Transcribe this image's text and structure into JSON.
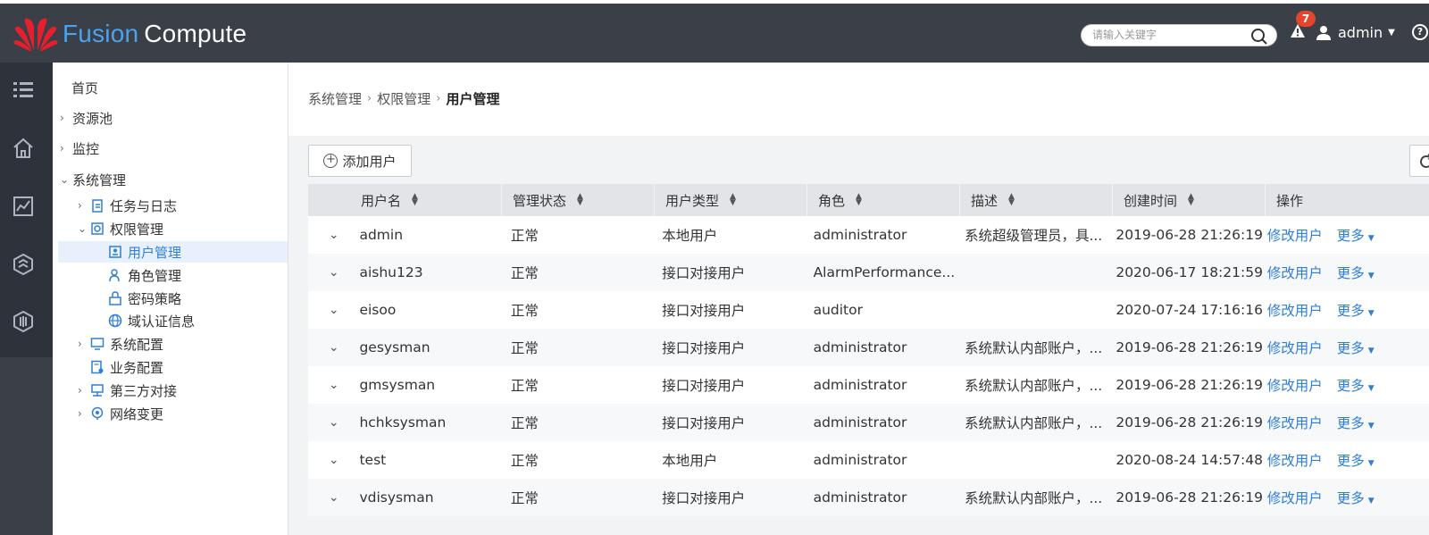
{
  "header": {
    "brand_part1": "Fusion",
    "brand_part2": "Compute",
    "search_placeholder": "请输入关键字",
    "alarm_count": "7",
    "user_name": "admin",
    "help_symbol": "?"
  },
  "rail_icons": [
    "list-icon",
    "home-icon",
    "monitor-chart-icon",
    "hexagon-icon",
    "shield-icon"
  ],
  "tree": {
    "home": "首页",
    "resource_pool": "资源池",
    "monitor": "监控",
    "system_mgmt": "系统管理",
    "task_log": "任务与日志",
    "permission_mgmt": "权限管理",
    "user_mgmt": "用户管理",
    "role_mgmt": "角色管理",
    "password_policy": "密码策略",
    "domain_auth": "域认证信息",
    "system_config": "系统配置",
    "business_config": "业务配置",
    "third_party": "第三方对接",
    "network_change": "网络变更"
  },
  "breadcrumb": {
    "level1": "系统管理",
    "level2": "权限管理",
    "current": "用户管理"
  },
  "toolbar": {
    "add_user": "添加用户"
  },
  "table": {
    "columns": {
      "username": "用户名",
      "status": "管理状态",
      "user_type": "用户类型",
      "role": "角色",
      "description": "描述",
      "created": "创建时间",
      "actions": "操作"
    },
    "action_edit": "修改用户",
    "action_more": "更多",
    "rows": [
      {
        "username": "admin",
        "status": "正常",
        "user_type": "本地用户",
        "role": "administrator",
        "description": "系统超级管理员，具...",
        "created": "2019-06-28 21:26:19"
      },
      {
        "username": "aishu123",
        "status": "正常",
        "user_type": "接口对接用户",
        "role": "AlarmPerformance...",
        "description": "",
        "created": "2020-06-17 18:21:59"
      },
      {
        "username": "eisoo",
        "status": "正常",
        "user_type": "接口对接用户",
        "role": "auditor",
        "description": "",
        "created": "2020-07-24 17:16:16"
      },
      {
        "username": "gesysman",
        "status": "正常",
        "user_type": "接口对接用户",
        "role": "administrator",
        "description": "系统默认内部账户，...",
        "created": "2019-06-28 21:26:19"
      },
      {
        "username": "gmsysman",
        "status": "正常",
        "user_type": "接口对接用户",
        "role": "administrator",
        "description": "系统默认内部账户，...",
        "created": "2019-06-28 21:26:19"
      },
      {
        "username": "hchksysman",
        "status": "正常",
        "user_type": "接口对接用户",
        "role": "administrator",
        "description": "系统默认内部账户，...",
        "created": "2019-06-28 21:26:19"
      },
      {
        "username": "test",
        "status": "正常",
        "user_type": "本地用户",
        "role": "administrator",
        "description": "",
        "created": "2020-08-24 14:57:48"
      },
      {
        "username": "vdisysman",
        "status": "正常",
        "user_type": "接口对接用户",
        "role": "administrator",
        "description": "系统默认内部账户，...",
        "created": "2019-06-28 21:26:19"
      }
    ]
  },
  "colors": {
    "topbar": "#3b3f47",
    "brand_blue": "#4aa3f0",
    "link": "#2f7fd8",
    "badge": "#e5452c",
    "selected_bg": "#e8f1fb"
  }
}
